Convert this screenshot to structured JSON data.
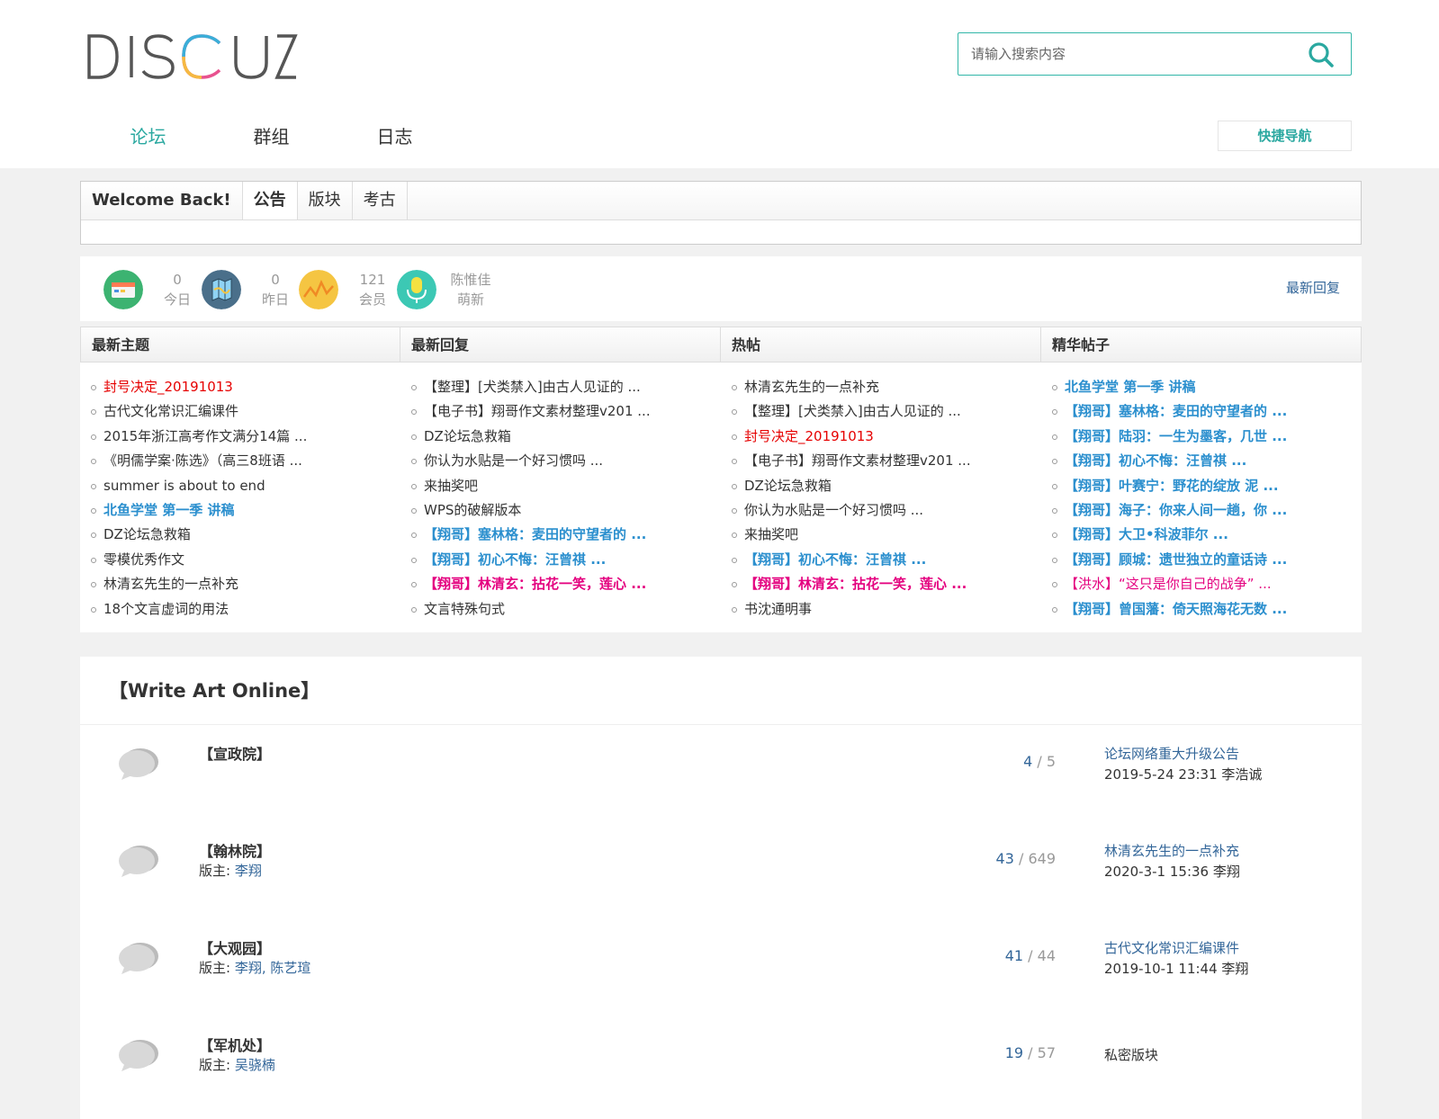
{
  "header": {
    "logo_text": "DISCUZ",
    "search_placeholder": "请输入搜索内容",
    "nav": [
      "论坛",
      "群组",
      "日志"
    ],
    "quick_nav": "快捷导航"
  },
  "welcome": {
    "tabs": [
      "Welcome Back!",
      "公告",
      "版块",
      "考古"
    ]
  },
  "stats": {
    "items": [
      {
        "num": "0",
        "label": "今日",
        "icon": "calendar-icon",
        "color": "#3cb371"
      },
      {
        "num": "0",
        "label": "昨日",
        "icon": "map-icon",
        "color": "#4a6f8a"
      },
      {
        "num": "121",
        "label": "会员",
        "icon": "chart-icon",
        "color": "#f5c542"
      },
      {
        "num": "陈惟佳",
        "label": "萌新",
        "icon": "microphone-icon",
        "color": "#3cc8b4"
      }
    ],
    "latest_reply": "最新回复"
  },
  "columns": [
    {
      "title": "最新主题",
      "items": [
        {
          "text": "封号决定_20191013",
          "style": "red"
        },
        {
          "text": "古代文化常识汇编课件",
          "style": ""
        },
        {
          "text": "2015年浙江高考作文满分14篇 ...",
          "style": ""
        },
        {
          "text": "《明儒学案·陈选》（高三8班语 ...",
          "style": ""
        },
        {
          "text": "summer is about to end",
          "style": ""
        },
        {
          "text": "北鱼学堂 第一季 讲稿",
          "style": "blue"
        },
        {
          "text": "DZ论坛急救箱",
          "style": ""
        },
        {
          "text": "零模优秀作文",
          "style": ""
        },
        {
          "text": "林清玄先生的一点补充",
          "style": ""
        },
        {
          "text": "18个文言虚词的用法",
          "style": ""
        }
      ]
    },
    {
      "title": "最新回复",
      "items": [
        {
          "text": "【整理】[犬类禁入]由古人见证的 ...",
          "style": ""
        },
        {
          "text": "【电子书】翔哥作文素材整理v201 ...",
          "style": ""
        },
        {
          "text": "DZ论坛急救箱",
          "style": ""
        },
        {
          "text": "你认为水贴是一个好习惯吗 ...",
          "style": ""
        },
        {
          "text": "来抽奖吧",
          "style": ""
        },
        {
          "text": "WPS的破解版本",
          "style": ""
        },
        {
          "text": "【翔哥】塞林格：麦田的守望者的 ...",
          "style": "blue"
        },
        {
          "text": "【翔哥】初心不悔：汪曾祺 ...",
          "style": "blue"
        },
        {
          "text": "【翔哥】林清玄：拈花一笑，莲心 ...",
          "style": "pink"
        },
        {
          "text": "文言特殊句式",
          "style": ""
        }
      ]
    },
    {
      "title": "热帖",
      "items": [
        {
          "text": "林清玄先生的一点补充",
          "style": ""
        },
        {
          "text": "【整理】[犬类禁入]由古人见证的 ...",
          "style": ""
        },
        {
          "text": "封号决定_20191013",
          "style": "red"
        },
        {
          "text": "【电子书】翔哥作文素材整理v201 ...",
          "style": ""
        },
        {
          "text": "DZ论坛急救箱",
          "style": ""
        },
        {
          "text": "你认为水贴是一个好习惯吗 ...",
          "style": ""
        },
        {
          "text": "来抽奖吧",
          "style": ""
        },
        {
          "text": "【翔哥】初心不悔：汪曾祺 ...",
          "style": "blue"
        },
        {
          "text": "【翔哥】林清玄：拈花一笑，莲心 ...",
          "style": "pink"
        },
        {
          "text": "书沈通明事",
          "style": ""
        }
      ]
    },
    {
      "title": "精华帖子",
      "items": [
        {
          "text": "北鱼学堂 第一季 讲稿",
          "style": "blue"
        },
        {
          "text": "【翔哥】塞林格：麦田的守望者的 ...",
          "style": "blue"
        },
        {
          "text": "【翔哥】陆羽：一生为墨客，几世 ...",
          "style": "blue"
        },
        {
          "text": "【翔哥】初心不悔：汪曾祺 ...",
          "style": "blue"
        },
        {
          "text": "【翔哥】叶赛宁：野花的绽放 泥 ...",
          "style": "blue"
        },
        {
          "text": "【翔哥】海子：你来人间一趟，你 ...",
          "style": "blue"
        },
        {
          "text": "【翔哥】大卫•科波菲尔 ...",
          "style": "blue"
        },
        {
          "text": "【翔哥】顾城：遗世独立的童话诗 ...",
          "style": "blue"
        },
        {
          "text": "【洪水】“这只是你自己的战争” ...",
          "style": "pinkn"
        },
        {
          "text": "【翔哥】曾国藩：倚天照海花无数 ...",
          "style": "blue"
        }
      ]
    }
  ],
  "forum": {
    "title": "【Write Art Online】",
    "rows": [
      {
        "name": "【宣政院】",
        "mods_label": "",
        "mods": "",
        "threads": "4",
        "posts": "5",
        "last_title": "论坛网络重大升级公告",
        "last_meta": "2019-5-24 23:31 李浩诚",
        "private": ""
      },
      {
        "name": "【翰林院】",
        "mods_label": "版主:",
        "mods": "李翔",
        "threads": "43",
        "posts": "649",
        "last_title": "林清玄先生的一点补充",
        "last_meta": "2020-3-1 15:36 李翔",
        "private": ""
      },
      {
        "name": "【大观园】",
        "mods_label": "版主:",
        "mods": "李翔, 陈艺瑄",
        "threads": "41",
        "posts": "44",
        "last_title": "古代文化常识汇编课件",
        "last_meta": "2019-10-1 11:44 李翔",
        "private": ""
      },
      {
        "name": "【军机处】",
        "mods_label": "版主:",
        "mods": "吴骁楠",
        "threads": "19",
        "posts": "57",
        "last_title": "",
        "last_meta": "",
        "private": "私密版块"
      }
    ]
  }
}
